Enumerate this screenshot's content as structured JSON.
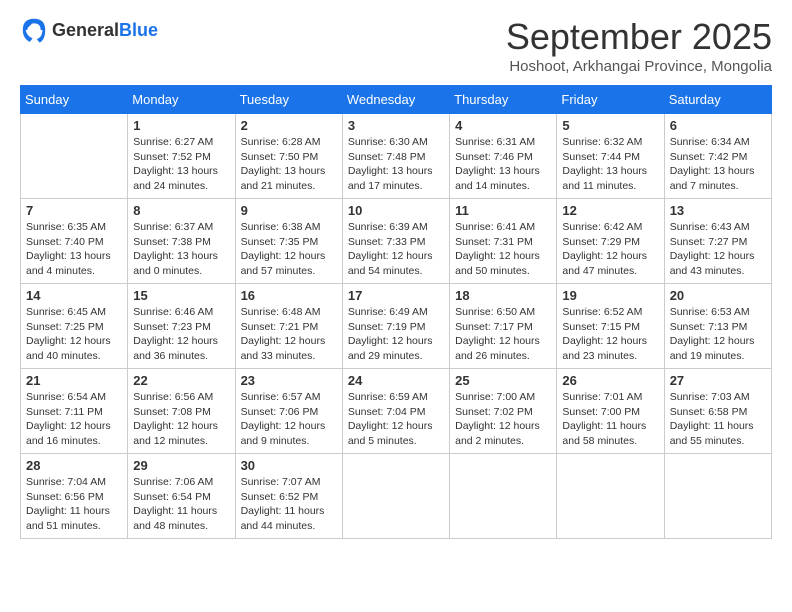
{
  "logo": {
    "general": "General",
    "blue": "Blue"
  },
  "title": "September 2025",
  "location": "Hoshoot, Arkhangai Province, Mongolia",
  "days_of_week": [
    "Sunday",
    "Monday",
    "Tuesday",
    "Wednesday",
    "Thursday",
    "Friday",
    "Saturday"
  ],
  "weeks": [
    [
      {
        "day": "",
        "sunrise": "",
        "sunset": "",
        "daylight": ""
      },
      {
        "day": "1",
        "sunrise": "Sunrise: 6:27 AM",
        "sunset": "Sunset: 7:52 PM",
        "daylight": "Daylight: 13 hours and 24 minutes."
      },
      {
        "day": "2",
        "sunrise": "Sunrise: 6:28 AM",
        "sunset": "Sunset: 7:50 PM",
        "daylight": "Daylight: 13 hours and 21 minutes."
      },
      {
        "day": "3",
        "sunrise": "Sunrise: 6:30 AM",
        "sunset": "Sunset: 7:48 PM",
        "daylight": "Daylight: 13 hours and 17 minutes."
      },
      {
        "day": "4",
        "sunrise": "Sunrise: 6:31 AM",
        "sunset": "Sunset: 7:46 PM",
        "daylight": "Daylight: 13 hours and 14 minutes."
      },
      {
        "day": "5",
        "sunrise": "Sunrise: 6:32 AM",
        "sunset": "Sunset: 7:44 PM",
        "daylight": "Daylight: 13 hours and 11 minutes."
      },
      {
        "day": "6",
        "sunrise": "Sunrise: 6:34 AM",
        "sunset": "Sunset: 7:42 PM",
        "daylight": "Daylight: 13 hours and 7 minutes."
      }
    ],
    [
      {
        "day": "7",
        "sunrise": "Sunrise: 6:35 AM",
        "sunset": "Sunset: 7:40 PM",
        "daylight": "Daylight: 13 hours and 4 minutes."
      },
      {
        "day": "8",
        "sunrise": "Sunrise: 6:37 AM",
        "sunset": "Sunset: 7:38 PM",
        "daylight": "Daylight: 13 hours and 0 minutes."
      },
      {
        "day": "9",
        "sunrise": "Sunrise: 6:38 AM",
        "sunset": "Sunset: 7:35 PM",
        "daylight": "Daylight: 12 hours and 57 minutes."
      },
      {
        "day": "10",
        "sunrise": "Sunrise: 6:39 AM",
        "sunset": "Sunset: 7:33 PM",
        "daylight": "Daylight: 12 hours and 54 minutes."
      },
      {
        "day": "11",
        "sunrise": "Sunrise: 6:41 AM",
        "sunset": "Sunset: 7:31 PM",
        "daylight": "Daylight: 12 hours and 50 minutes."
      },
      {
        "day": "12",
        "sunrise": "Sunrise: 6:42 AM",
        "sunset": "Sunset: 7:29 PM",
        "daylight": "Daylight: 12 hours and 47 minutes."
      },
      {
        "day": "13",
        "sunrise": "Sunrise: 6:43 AM",
        "sunset": "Sunset: 7:27 PM",
        "daylight": "Daylight: 12 hours and 43 minutes."
      }
    ],
    [
      {
        "day": "14",
        "sunrise": "Sunrise: 6:45 AM",
        "sunset": "Sunset: 7:25 PM",
        "daylight": "Daylight: 12 hours and 40 minutes."
      },
      {
        "day": "15",
        "sunrise": "Sunrise: 6:46 AM",
        "sunset": "Sunset: 7:23 PM",
        "daylight": "Daylight: 12 hours and 36 minutes."
      },
      {
        "day": "16",
        "sunrise": "Sunrise: 6:48 AM",
        "sunset": "Sunset: 7:21 PM",
        "daylight": "Daylight: 12 hours and 33 minutes."
      },
      {
        "day": "17",
        "sunrise": "Sunrise: 6:49 AM",
        "sunset": "Sunset: 7:19 PM",
        "daylight": "Daylight: 12 hours and 29 minutes."
      },
      {
        "day": "18",
        "sunrise": "Sunrise: 6:50 AM",
        "sunset": "Sunset: 7:17 PM",
        "daylight": "Daylight: 12 hours and 26 minutes."
      },
      {
        "day": "19",
        "sunrise": "Sunrise: 6:52 AM",
        "sunset": "Sunset: 7:15 PM",
        "daylight": "Daylight: 12 hours and 23 minutes."
      },
      {
        "day": "20",
        "sunrise": "Sunrise: 6:53 AM",
        "sunset": "Sunset: 7:13 PM",
        "daylight": "Daylight: 12 hours and 19 minutes."
      }
    ],
    [
      {
        "day": "21",
        "sunrise": "Sunrise: 6:54 AM",
        "sunset": "Sunset: 7:11 PM",
        "daylight": "Daylight: 12 hours and 16 minutes."
      },
      {
        "day": "22",
        "sunrise": "Sunrise: 6:56 AM",
        "sunset": "Sunset: 7:08 PM",
        "daylight": "Daylight: 12 hours and 12 minutes."
      },
      {
        "day": "23",
        "sunrise": "Sunrise: 6:57 AM",
        "sunset": "Sunset: 7:06 PM",
        "daylight": "Daylight: 12 hours and 9 minutes."
      },
      {
        "day": "24",
        "sunrise": "Sunrise: 6:59 AM",
        "sunset": "Sunset: 7:04 PM",
        "daylight": "Daylight: 12 hours and 5 minutes."
      },
      {
        "day": "25",
        "sunrise": "Sunrise: 7:00 AM",
        "sunset": "Sunset: 7:02 PM",
        "daylight": "Daylight: 12 hours and 2 minutes."
      },
      {
        "day": "26",
        "sunrise": "Sunrise: 7:01 AM",
        "sunset": "Sunset: 7:00 PM",
        "daylight": "Daylight: 11 hours and 58 minutes."
      },
      {
        "day": "27",
        "sunrise": "Sunrise: 7:03 AM",
        "sunset": "Sunset: 6:58 PM",
        "daylight": "Daylight: 11 hours and 55 minutes."
      }
    ],
    [
      {
        "day": "28",
        "sunrise": "Sunrise: 7:04 AM",
        "sunset": "Sunset: 6:56 PM",
        "daylight": "Daylight: 11 hours and 51 minutes."
      },
      {
        "day": "29",
        "sunrise": "Sunrise: 7:06 AM",
        "sunset": "Sunset: 6:54 PM",
        "daylight": "Daylight: 11 hours and 48 minutes."
      },
      {
        "day": "30",
        "sunrise": "Sunrise: 7:07 AM",
        "sunset": "Sunset: 6:52 PM",
        "daylight": "Daylight: 11 hours and 44 minutes."
      },
      {
        "day": "",
        "sunrise": "",
        "sunset": "",
        "daylight": ""
      },
      {
        "day": "",
        "sunrise": "",
        "sunset": "",
        "daylight": ""
      },
      {
        "day": "",
        "sunrise": "",
        "sunset": "",
        "daylight": ""
      },
      {
        "day": "",
        "sunrise": "",
        "sunset": "",
        "daylight": ""
      }
    ]
  ]
}
